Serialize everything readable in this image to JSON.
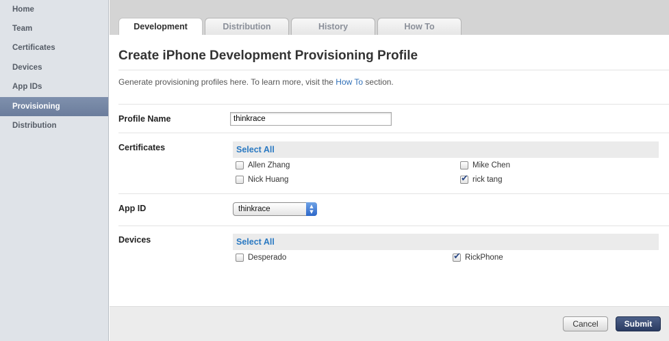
{
  "sidebar": {
    "items": [
      {
        "label": "Home"
      },
      {
        "label": "Team"
      },
      {
        "label": "Certificates"
      },
      {
        "label": "Devices"
      },
      {
        "label": "App IDs"
      },
      {
        "label": "Provisioning",
        "active": true
      },
      {
        "label": "Distribution"
      }
    ]
  },
  "tabs": [
    {
      "label": "Development",
      "active": true
    },
    {
      "label": "Distribution"
    },
    {
      "label": "History"
    },
    {
      "label": "How To"
    }
  ],
  "page": {
    "title": "Create iPhone Development Provisioning Profile",
    "intro_prefix": "Generate provisioning profiles here. To learn more, visit the ",
    "intro_link": "How To",
    "intro_suffix": " section."
  },
  "form": {
    "profile_name": {
      "label": "Profile Name",
      "value": "thinkrace"
    },
    "certificates": {
      "label": "Certificates",
      "select_all": "Select All",
      "items": [
        {
          "name": "Allen Zhang",
          "checked": false
        },
        {
          "name": "Mike Chen",
          "checked": false
        },
        {
          "name": "Nick Huang",
          "checked": false
        },
        {
          "name": "rick tang",
          "checked": true
        }
      ]
    },
    "app_id": {
      "label": "App ID",
      "selected": "thinkrace"
    },
    "devices": {
      "label": "Devices",
      "select_all": "Select All",
      "items": [
        {
          "name": "Desperado",
          "checked": false
        },
        {
          "name": "RickPhone",
          "checked": true
        }
      ]
    }
  },
  "buttons": {
    "cancel": "Cancel",
    "submit": "Submit"
  },
  "colors": {
    "link": "#2f6fb7",
    "sidebar_active": "#6b7d9c",
    "submit": "#2a3b62"
  }
}
